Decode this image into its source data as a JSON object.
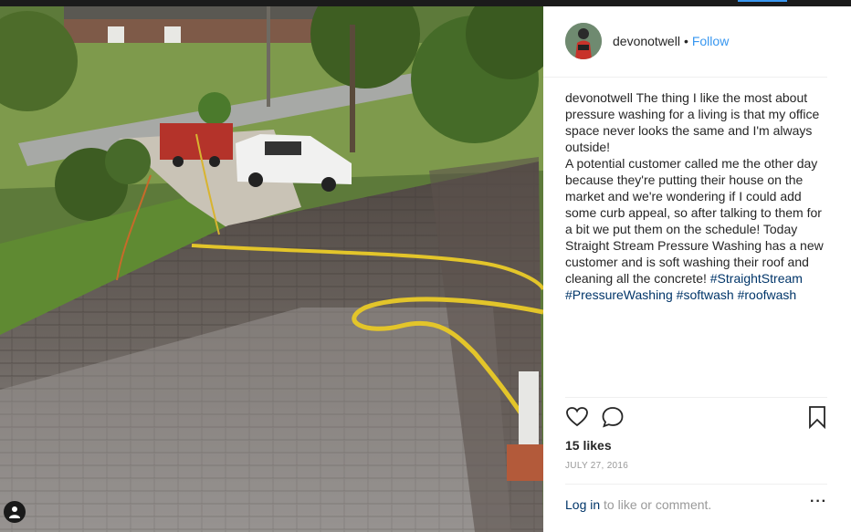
{
  "post": {
    "username": "devonotwell",
    "dot": "•",
    "follow_label": "Follow",
    "caption_user": "devonotwell",
    "caption_p1": "The thing I like the most about pressure washing for a living is that my office space never looks the same and I'm always outside!",
    "caption_p2": "A potential customer called me the other day because they're putting their house on the market and we're wondering if I could add some curb appeal, so after talking to them for a bit we put them on the schedule! Today Straight Stream Pressure Washing has a new customer and is soft washing their roof and cleaning all the concrete!",
    "hashtags": [
      "#StraightStream",
      "#PressureWashing",
      "#softwash",
      "#roofwash"
    ],
    "likes": "15 likes",
    "date": "JULY 27, 2016",
    "login_link": "Log in",
    "login_rest": "to like or comment.",
    "more_label": "···"
  },
  "icons": {
    "like": "heart-icon",
    "comment": "comment-icon",
    "save": "bookmark-icon",
    "tag": "user-tag-icon",
    "more": "more-options-icon"
  },
  "colors": {
    "link": "#3897f0",
    "hashtag": "#003569",
    "muted": "#999999",
    "text": "#262626"
  }
}
